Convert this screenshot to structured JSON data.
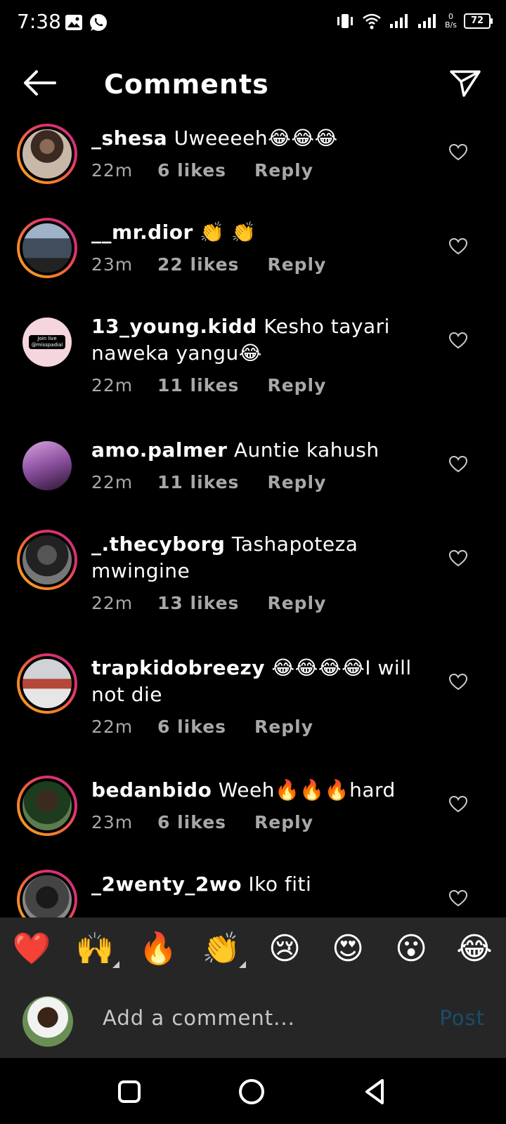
{
  "status_bar": {
    "time": "7:38",
    "net_speed_value": "0",
    "net_speed_unit": "B/s",
    "battery": "72"
  },
  "header": {
    "title": "Comments"
  },
  "comments": [
    {
      "user": "_shesa",
      "text": "Uweeeeh😂😂😂",
      "time": "22m",
      "likes": "6 likes",
      "reply": "Reply"
    },
    {
      "user": "__mr.dior",
      "text": "👏 👏",
      "time": "23m",
      "likes": "22 likes",
      "reply": "Reply"
    },
    {
      "user": "13_young.kidd",
      "text": "Kesho tayari naweka yangu😂",
      "time": "22m",
      "likes": "11 likes",
      "reply": "Reply",
      "avatar_text_1": "Join live",
      "avatar_text_2": "@misspadial"
    },
    {
      "user": "amo.palmer",
      "text": "Auntie kahush",
      "time": "22m",
      "likes": "11 likes",
      "reply": "Reply"
    },
    {
      "user": "_.thecyborg",
      "text": "Tashapoteza mwingine",
      "time": "22m",
      "likes": "13 likes",
      "reply": "Reply"
    },
    {
      "user": "trapkidobreezy",
      "text": "😂😂😂😂I will not die",
      "time": "22m",
      "likes": "6 likes",
      "reply": "Reply"
    },
    {
      "user": "bedanbido",
      "text": "Weeh🔥🔥🔥hard",
      "time": "23m",
      "likes": "6 likes",
      "reply": "Reply"
    },
    {
      "user": "_2wenty_2wo",
      "text": "Iko fiti",
      "time": "",
      "likes": "",
      "reply": ""
    }
  ],
  "emoji_bar": [
    "❤️",
    "🙌",
    "🔥",
    "👏",
    "😢",
    "😍",
    "😮",
    "😂"
  ],
  "input": {
    "placeholder": "Add a comment...",
    "post_label": "Post"
  },
  "colors": {
    "background": "#000000",
    "bar": "#262626",
    "post_disabled": "#1a4d6e",
    "meta": "#a8a8a8"
  }
}
